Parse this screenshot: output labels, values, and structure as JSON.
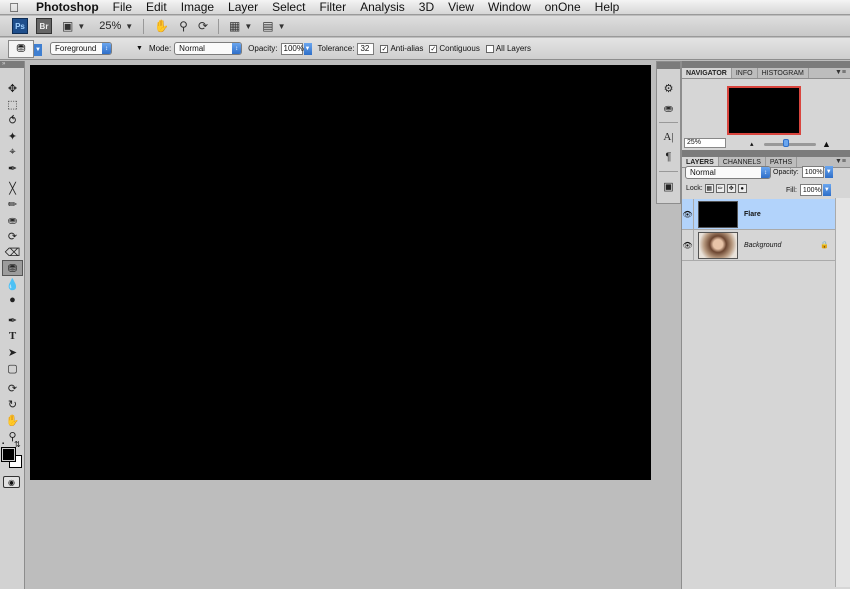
{
  "menubar": {
    "app_name": "Photoshop",
    "items": [
      "File",
      "Edit",
      "Image",
      "Layer",
      "Select",
      "Filter",
      "Analysis",
      "3D",
      "View",
      "Window",
      "onOne",
      "Help"
    ]
  },
  "appbar": {
    "ps_logo": "Ps",
    "br_logo": "Br",
    "zoom": "25%"
  },
  "options": {
    "fill_source": "Foreground",
    "mode_label": "Mode:",
    "mode_value": "Normal",
    "opacity_label": "Opacity:",
    "opacity_value": "100%",
    "tolerance_label": "Tolerance:",
    "tolerance_value": "32",
    "anti_alias_label": "Anti-alias",
    "anti_alias_checked": true,
    "contiguous_label": "Contiguous",
    "contiguous_checked": true,
    "all_layers_label": "All Layers",
    "all_layers_checked": false
  },
  "navigator": {
    "tabs": [
      "NAVIGATOR",
      "INFO",
      "HISTOGRAM"
    ],
    "active_tab": "NAVIGATOR",
    "zoom": "25%"
  },
  "layers": {
    "tabs": [
      "LAYERS",
      "CHANNELS",
      "PATHS"
    ],
    "active_tab": "LAYERS",
    "blend_mode": "Normal",
    "opacity_label": "Opacity:",
    "opacity_value": "100%",
    "lock_label": "Lock:",
    "fill_label": "Fill:",
    "fill_value": "100%",
    "items": [
      {
        "name": "Flare",
        "selected": true
      },
      {
        "name": "Background",
        "selected": false,
        "locked": true
      }
    ]
  },
  "colors": {
    "foreground": "#000000",
    "background": "#ffffff",
    "selection": "#b2d3fb"
  }
}
